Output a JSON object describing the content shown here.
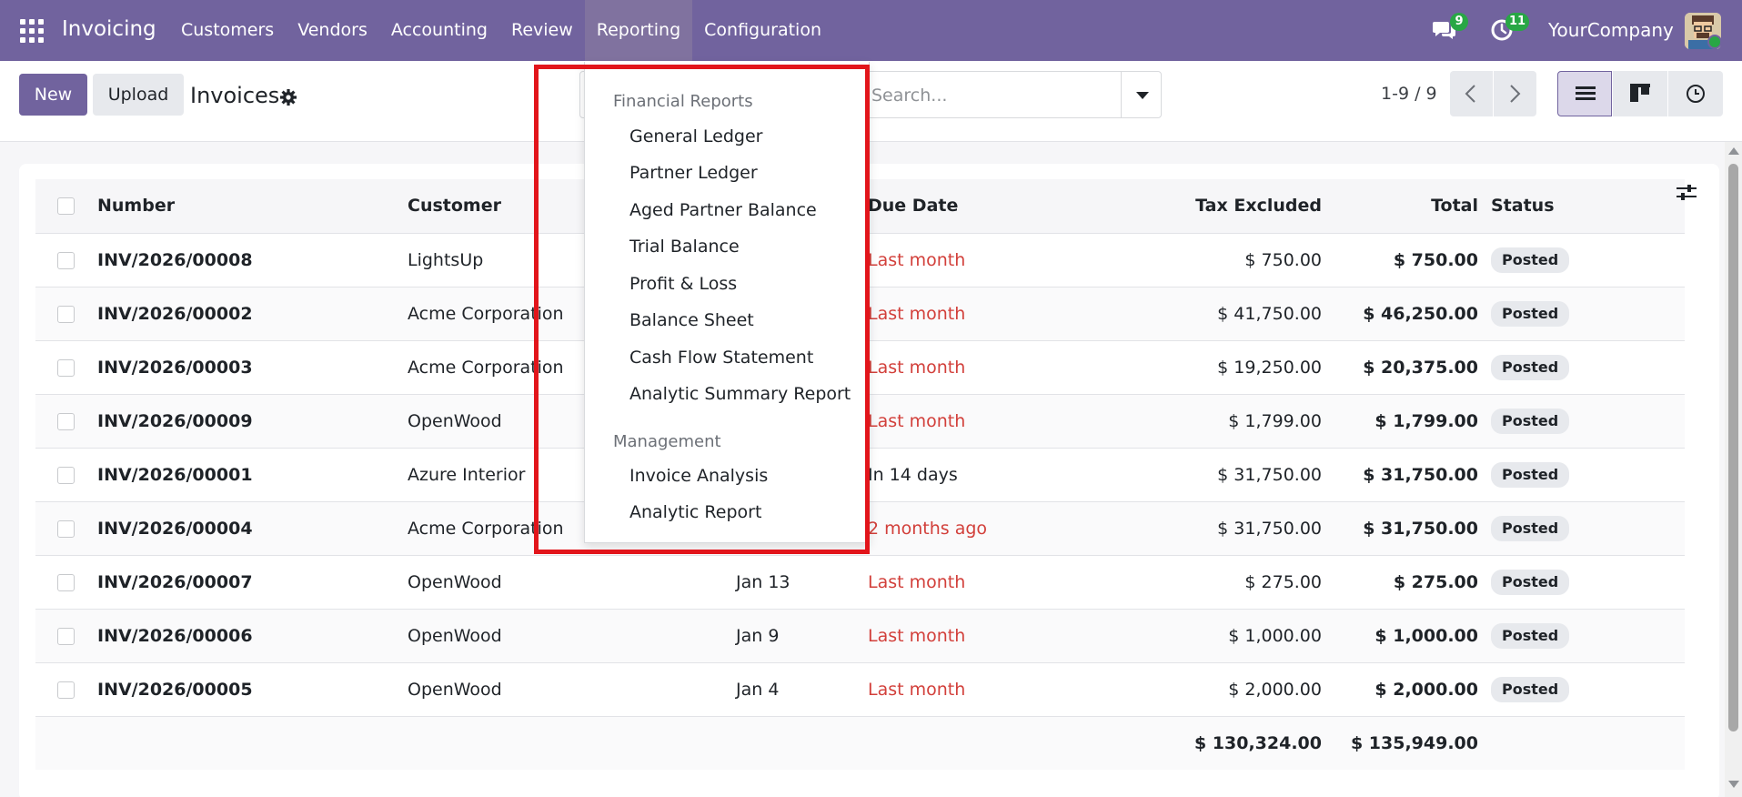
{
  "navbar": {
    "app_name": "Invoicing",
    "menu": [
      "Customers",
      "Vendors",
      "Accounting",
      "Review",
      "Reporting",
      "Configuration"
    ],
    "active_menu": "Reporting",
    "chat_count": "9",
    "activity_count": "11",
    "company": "YourCompany",
    "accent_color": "#71639e"
  },
  "control": {
    "new_label": "New",
    "upload_label": "Upload",
    "title": "Invoices",
    "search_placeholder": "Search...",
    "pager": "1-9 / 9"
  },
  "table": {
    "columns": [
      "Number",
      "Customer",
      "Due Date",
      "Tax Excluded",
      "Total",
      "Status"
    ],
    "rows": [
      {
        "number": "INV/2026/00008",
        "customer": "LightsUp",
        "date": "",
        "due": "Last month",
        "tax": "$ 750.00",
        "total": "$ 750.00",
        "status": "Posted"
      },
      {
        "number": "INV/2026/00002",
        "customer": "Acme Corporation",
        "date": "",
        "due": "Last month",
        "tax": "$ 41,750.00",
        "total": "$ 46,250.00",
        "status": "Posted"
      },
      {
        "number": "INV/2026/00003",
        "customer": "Acme Corporation",
        "date": "",
        "due": "Last month",
        "tax": "$ 19,250.00",
        "total": "$ 20,375.00",
        "status": "Posted"
      },
      {
        "number": "INV/2026/00009",
        "customer": "OpenWood",
        "date": "",
        "due": "Last month",
        "tax": "$ 1,799.00",
        "total": "$ 1,799.00",
        "status": "Posted"
      },
      {
        "number": "INV/2026/00001",
        "customer": "Azure Interior",
        "date": "",
        "due": "In 14 days",
        "tax": "$ 31,750.00",
        "total": "$ 31,750.00",
        "status": "Posted"
      },
      {
        "number": "INV/2026/00004",
        "customer": "Acme Corporation",
        "date": "",
        "due": "2 months ago",
        "tax": "$ 31,750.00",
        "total": "$ 31,750.00",
        "status": "Posted"
      },
      {
        "number": "INV/2026/00007",
        "customer": "OpenWood",
        "date": "Jan 13",
        "due": "Last month",
        "tax": "$ 275.00",
        "total": "$ 275.00",
        "status": "Posted"
      },
      {
        "number": "INV/2026/00006",
        "customer": "OpenWood",
        "date": "Jan 9",
        "due": "Last month",
        "tax": "$ 1,000.00",
        "total": "$ 1,000.00",
        "status": "Posted"
      },
      {
        "number": "INV/2026/00005",
        "customer": "OpenWood",
        "date": "Jan 4",
        "due": "Last month",
        "tax": "$ 2,000.00",
        "total": "$ 2,000.00",
        "status": "Posted"
      }
    ],
    "overdue_color": "#d23f3a",
    "sum_tax": "$ 130,324.00",
    "sum_total": "$ 135,949.00"
  },
  "dropdown": {
    "sections": [
      {
        "header": "Financial Reports",
        "items": [
          "General Ledger",
          "Partner Ledger",
          "Aged Partner Balance",
          "Trial Balance",
          "Profit & Loss",
          "Balance Sheet",
          "Cash Flow Statement",
          "Analytic Summary Report"
        ]
      },
      {
        "header": "Management",
        "items": [
          "Invoice Analysis",
          "Analytic Report"
        ]
      }
    ],
    "highlight_color": "#e2151b"
  }
}
